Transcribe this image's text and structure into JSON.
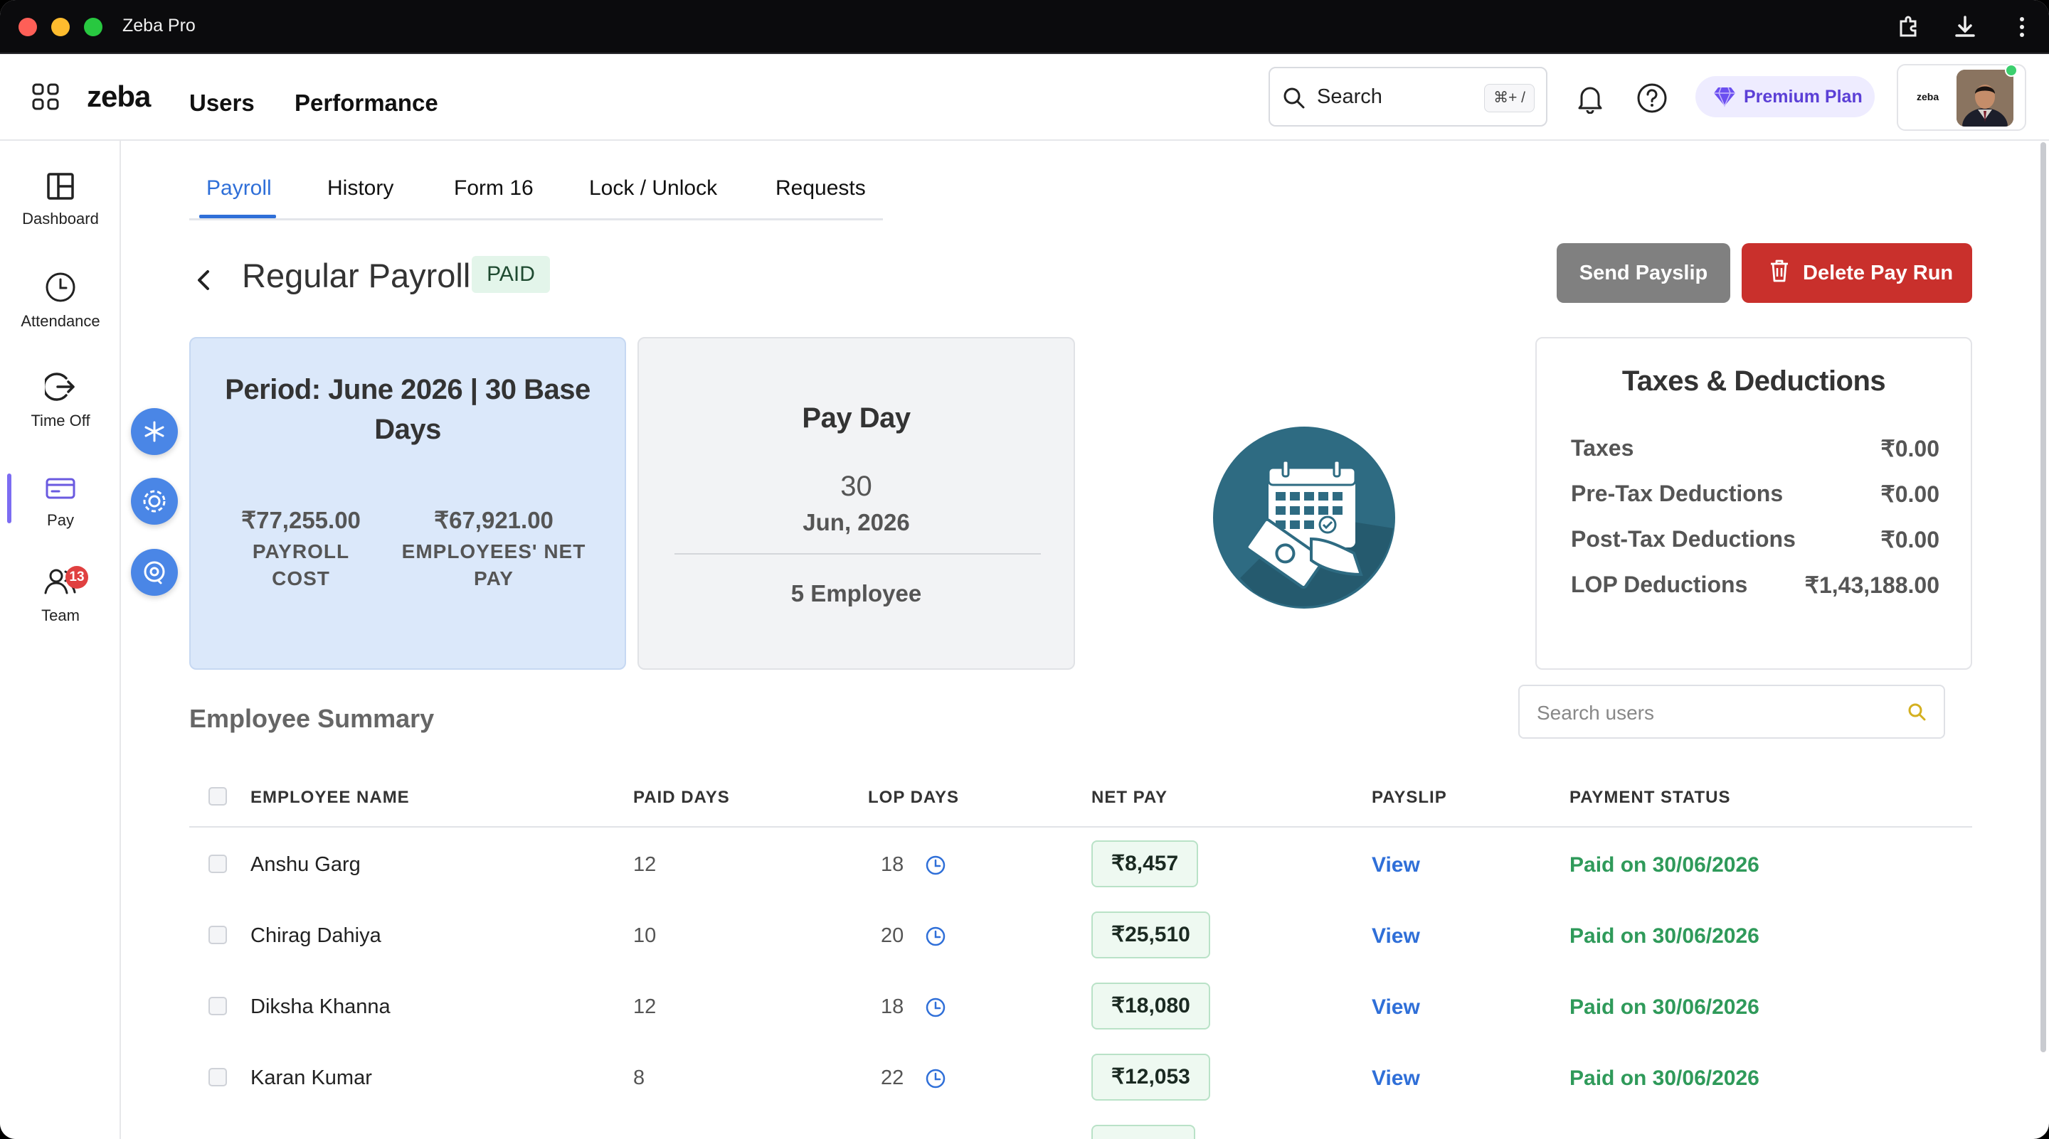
{
  "window": {
    "title": "Zeba Pro"
  },
  "header": {
    "logo": "zeba",
    "nav": [
      "Users",
      "Performance"
    ],
    "search": {
      "label": "Search",
      "shortcut": "⌘+ /"
    },
    "premium_label": "Premium Plan",
    "org_logo": "zeba"
  },
  "sidebar": {
    "items": [
      {
        "label": "Dashboard",
        "icon": "dashboard-icon"
      },
      {
        "label": "Attendance",
        "icon": "clock-icon"
      },
      {
        "label": "Time Off",
        "icon": "logout-icon"
      },
      {
        "label": "Pay",
        "icon": "card-icon"
      },
      {
        "label": "Team",
        "icon": "team-icon",
        "badge": "13"
      }
    ]
  },
  "tabs": [
    "Payroll",
    "History",
    "Form 16",
    "Lock / Unlock",
    "Requests"
  ],
  "page": {
    "title": "Regular Payroll",
    "status": "PAID",
    "send_label": "Send Payslip",
    "delete_label": "Delete Pay Run"
  },
  "period_card": {
    "title": "Period: June 2026 | 30 Base Days",
    "payroll_cost": "₹77,255.00",
    "payroll_cost_label": "PAYROLL COST",
    "net_pay": "₹67,921.00",
    "net_pay_label": "EMPLOYEES' NET PAY"
  },
  "payday_card": {
    "title": "Pay Day",
    "day": "30",
    "month_year": "Jun, 2026",
    "employees": "5 Employee"
  },
  "taxes_card": {
    "title": "Taxes & Deductions",
    "rows": [
      {
        "label": "Taxes",
        "value": "₹0.00"
      },
      {
        "label": "Pre-Tax Deductions",
        "value": "₹0.00"
      },
      {
        "label": "Post-Tax Deductions",
        "value": "₹0.00"
      },
      {
        "label": "LOP Deductions",
        "value": "₹1,43,188.00"
      }
    ]
  },
  "summary": {
    "title": "Employee Summary",
    "search_placeholder": "Search users",
    "columns": [
      "EMPLOYEE NAME",
      "PAID DAYS",
      "LOP DAYS",
      "NET PAY",
      "PAYSLIP",
      "PAYMENT STATUS"
    ],
    "rows": [
      {
        "name": "Anshu Garg",
        "paid_days": "12",
        "lop_days": "18",
        "net_pay": "₹8,457",
        "payslip": "View",
        "status": "Paid on 30/06/2026"
      },
      {
        "name": "Chirag Dahiya",
        "paid_days": "10",
        "lop_days": "20",
        "net_pay": "₹25,510",
        "payslip": "View",
        "status": "Paid on 30/06/2026"
      },
      {
        "name": "Diksha Khanna",
        "paid_days": "12",
        "lop_days": "18",
        "net_pay": "₹18,080",
        "payslip": "View",
        "status": "Paid on 30/06/2026"
      },
      {
        "name": "Karan Kumar",
        "paid_days": "8",
        "lop_days": "22",
        "net_pay": "₹12,053",
        "payslip": "View",
        "status": "Paid on 30/06/2026"
      }
    ]
  },
  "colors": {
    "accent": "#2f6fd8",
    "danger": "#c9302c",
    "success": "#2f9a5a",
    "premium": "#5b3fd6"
  }
}
